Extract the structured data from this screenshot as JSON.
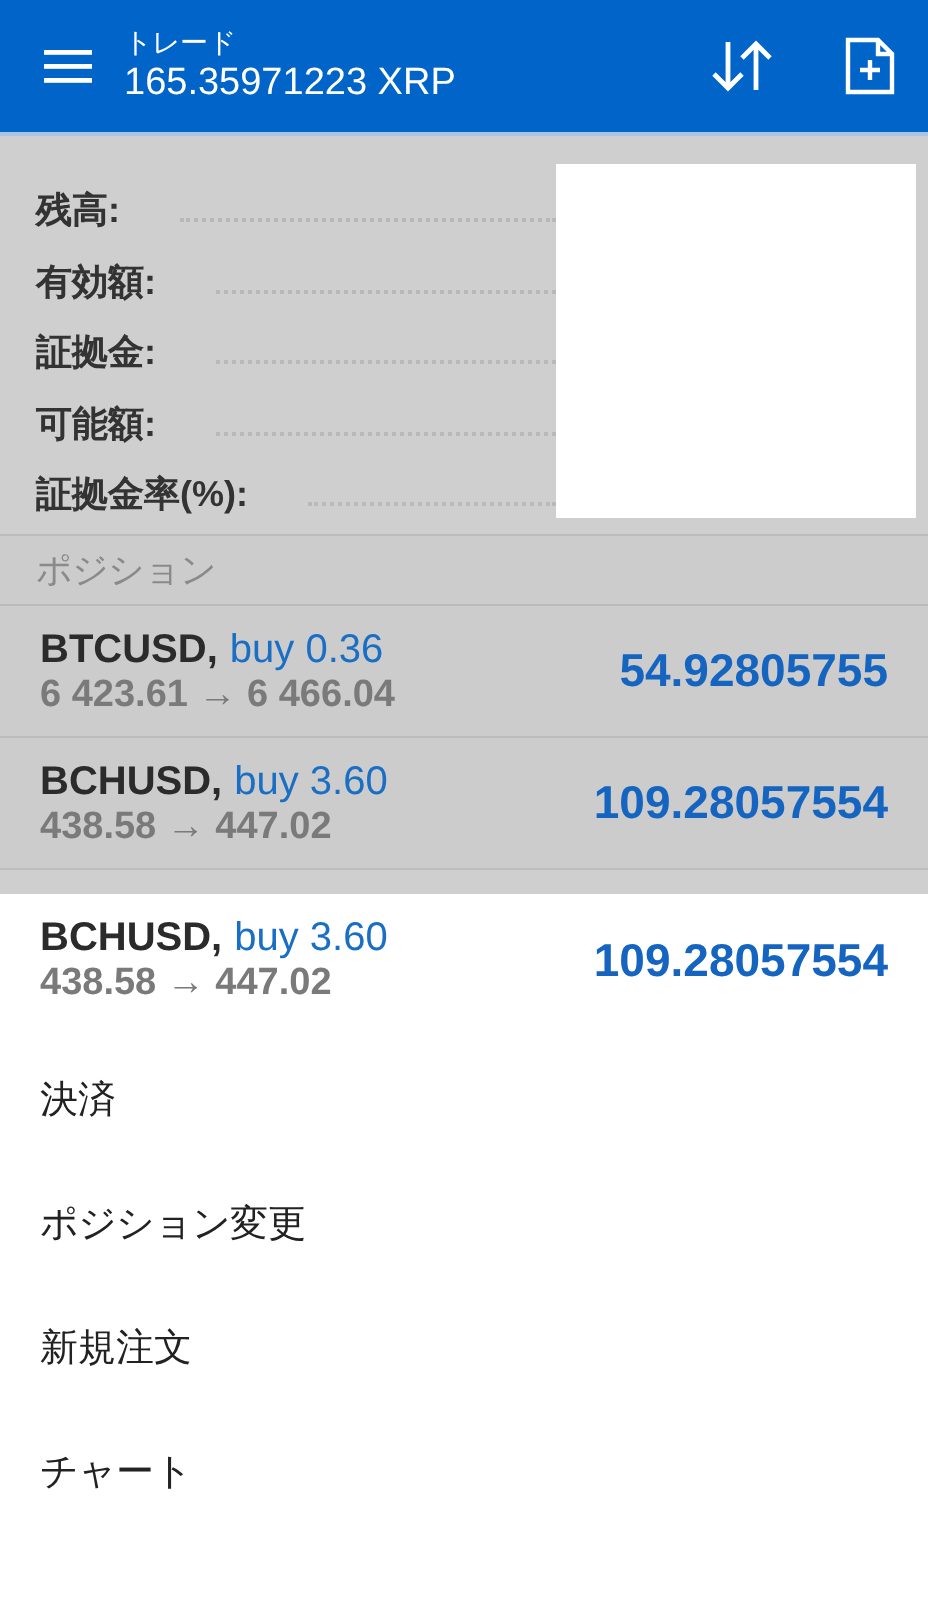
{
  "app_bar": {
    "title": "トレード",
    "subtitle": "165.35971223 XRP"
  },
  "account": {
    "fields": [
      {
        "label": "残高:"
      },
      {
        "label": "有効額:"
      },
      {
        "label": "証拠金:"
      },
      {
        "label": "可能額:"
      },
      {
        "label": "証拠金率(%):"
      }
    ]
  },
  "positions": {
    "header": "ポジション",
    "rows": [
      {
        "symbol": "BTCUSD,",
        "side": "buy 0.36",
        "prices": "6 423.61 → 6 466.04",
        "profit": "54.92805755"
      },
      {
        "symbol": "BCHUSD,",
        "side": "buy 3.60",
        "prices": "438.58 → 447.02",
        "profit": "109.28057554"
      }
    ]
  },
  "context_menu": {
    "position": {
      "symbol": "BCHUSD,",
      "side": "buy 3.60",
      "prices": "438.58 → 447.02",
      "profit": "109.28057554"
    },
    "items": [
      "決済",
      "ポジション変更",
      "新規注文",
      "チャート"
    ]
  }
}
